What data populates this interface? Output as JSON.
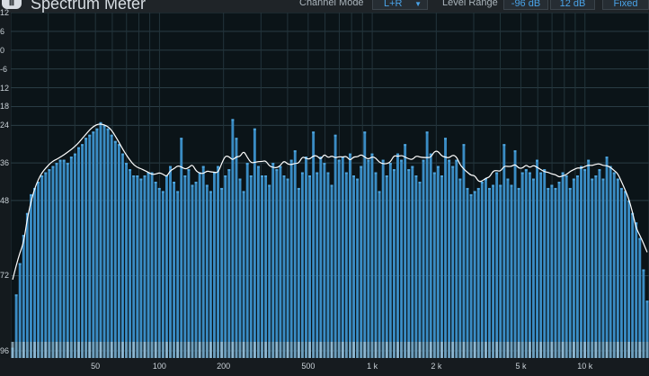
{
  "header": {
    "title": "Spectrum Meter",
    "channel_mode_label": "Channel Mode",
    "channel_mode_value": "L+R",
    "level_range_label": "Level Range",
    "level_min": "-96 dB",
    "level_max": "12 dB",
    "fixed_label": "Fixed"
  },
  "colors": {
    "bar": "#3a8cc4",
    "bar_top": "#4ea5de",
    "curve": "#ffffff",
    "accent": "#4aa3e8",
    "background": "#0b1418"
  },
  "chart_data": {
    "type": "bar",
    "y_tick_labels": [
      "12",
      "6",
      "0",
      "-6",
      "12",
      "18",
      "24",
      "36",
      "48",
      "72",
      "96"
    ],
    "x_tick_labels": [
      "50",
      "100",
      "200",
      "500",
      "1 k",
      "2 k",
      "5 k",
      "10 k"
    ],
    "x_tick_values": [
      50,
      100,
      200,
      500,
      1000,
      2000,
      5000,
      10000
    ],
    "xlim": [
      20,
      20000
    ],
    "ylim": [
      -96,
      12
    ],
    "x_scale": "log",
    "grid": true,
    "values": [
      -95,
      -78,
      -68,
      -59,
      -52,
      -46,
      -44,
      -42,
      -40,
      -39,
      -38,
      -37,
      -36,
      -35,
      -35,
      -36,
      -34,
      -33,
      -31,
      -30,
      -28,
      -27,
      -26,
      -25,
      -23,
      -24,
      -25,
      -27,
      -29,
      -30,
      -33,
      -36,
      -38,
      -40,
      -40,
      -41,
      -40,
      -39,
      -39,
      -42,
      -44,
      -45,
      -40,
      -37,
      -42,
      -45,
      -28,
      -40,
      -38,
      -43,
      -42,
      -39,
      -37,
      -43,
      -45,
      -39,
      -37,
      -44,
      -40,
      -38,
      -22,
      -28,
      -41,
      -45,
      -36,
      -40,
      -25,
      -37,
      -40,
      -40,
      -43,
      -36,
      -38,
      -37,
      -40,
      -41,
      -35,
      -32,
      -44,
      -39,
      -34,
      -40,
      -26,
      -39,
      -34,
      -36,
      -39,
      -43,
      -27,
      -35,
      -34,
      -39,
      -33,
      -40,
      -41,
      -37,
      -26,
      -35,
      -33,
      -39,
      -45,
      -35,
      -40,
      -36,
      -38,
      -33,
      -35,
      -30,
      -38,
      -37,
      -40,
      -42,
      -35,
      -26,
      -33,
      -39,
      -37,
      -40,
      -28,
      -35,
      -37,
      -35,
      -41,
      -30,
      -44,
      -46,
      -45,
      -44,
      -42,
      -41,
      -44,
      -43,
      -39,
      -43,
      -30,
      -41,
      -43,
      -32,
      -44,
      -39,
      -38,
      -39,
      -41,
      -35,
      -39,
      -38,
      -44,
      -43,
      -44,
      -42,
      -39,
      -40,
      -44,
      -41,
      -40,
      -37,
      -38,
      -35,
      -41,
      -40,
      -38,
      -41,
      -34,
      -37,
      -39,
      -41,
      -44,
      -45,
      -48,
      -52,
      -55,
      -60,
      -70,
      -80
    ]
  }
}
